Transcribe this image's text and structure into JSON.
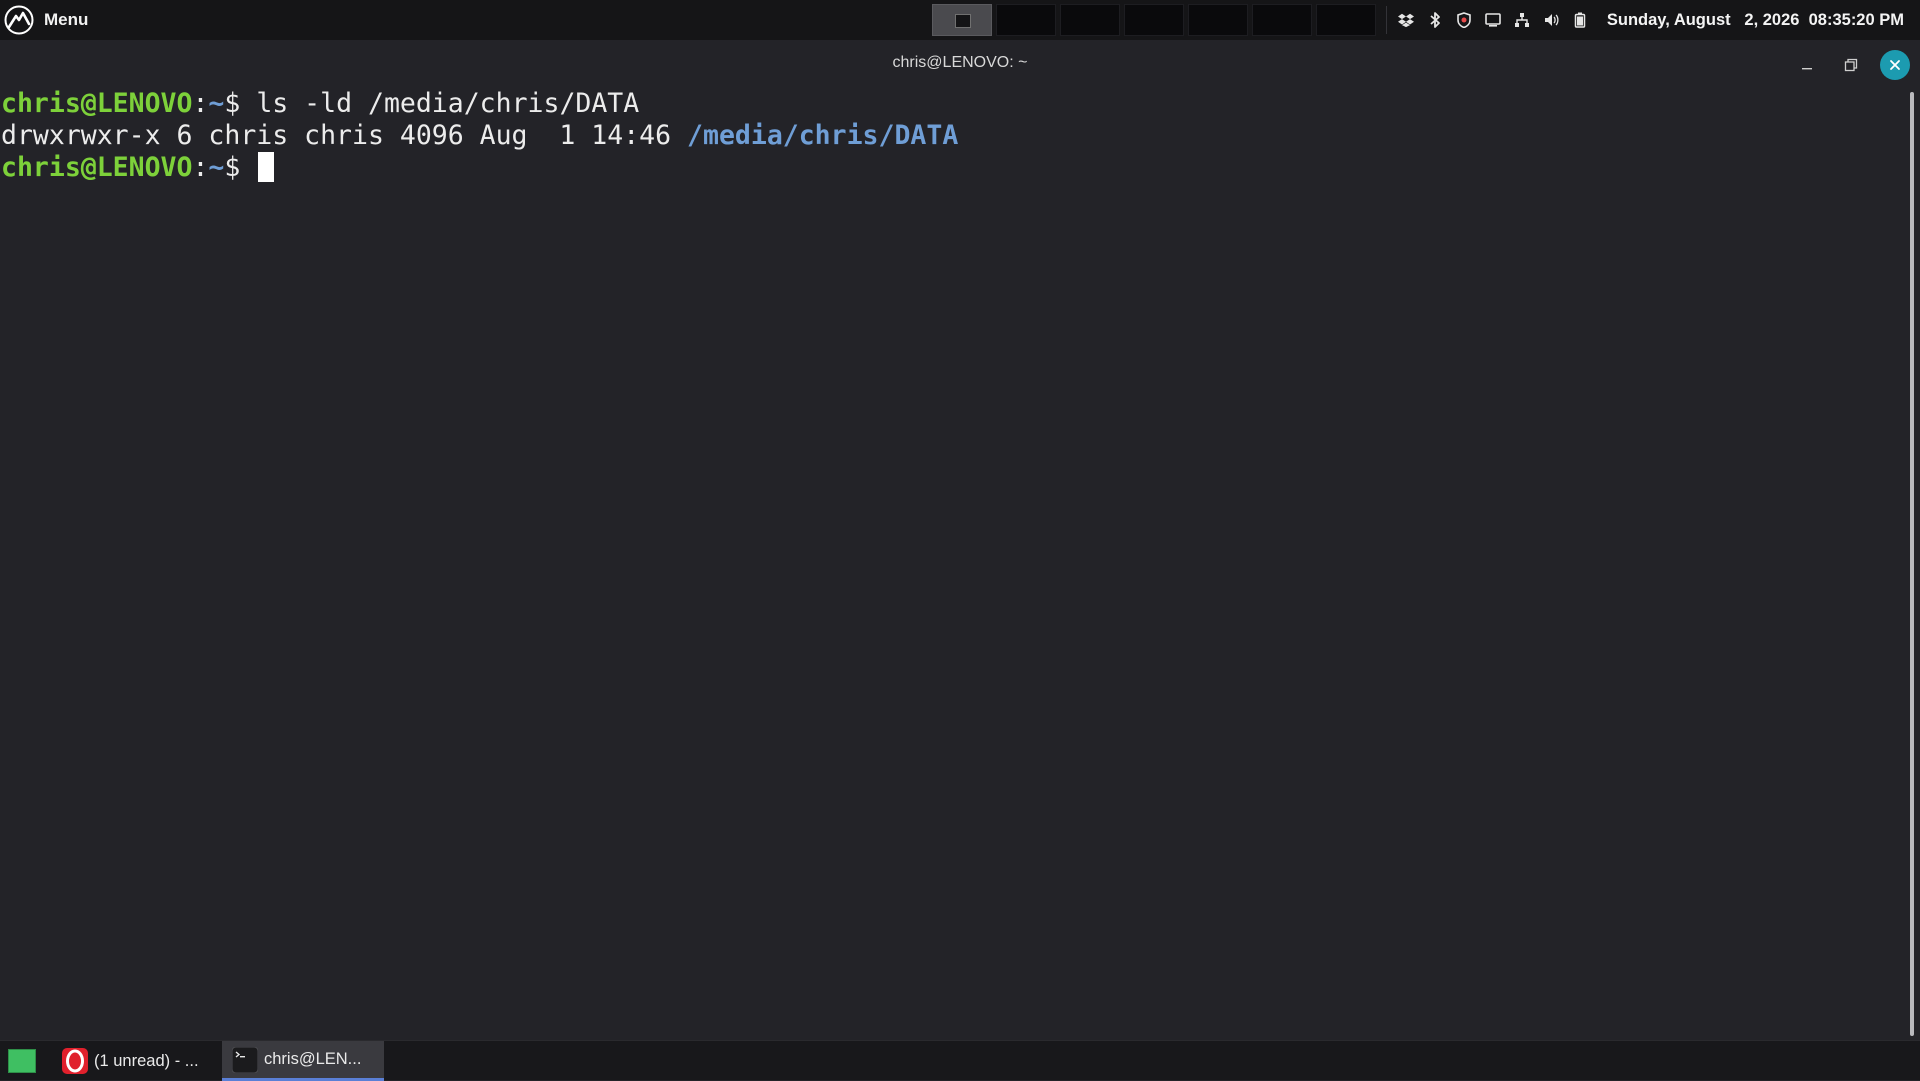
{
  "top_panel": {
    "menu_label": "Menu",
    "workspace_count": 7,
    "active_workspace": 1,
    "tray_icons": [
      "dropbox-icon",
      "bluetooth-icon",
      "shield-icon",
      "display-icon",
      "network-icon",
      "volume-icon",
      "battery-icon"
    ],
    "clock": "Sunday, August   2, 2026  08:35:20 PM"
  },
  "terminal": {
    "title": "chris@LENOVO: ~",
    "lines": [
      {
        "user_host": "chris@LENOVO",
        "colon": ":",
        "path": "~",
        "symbol": "$ ",
        "command": "ls -ld /media/chris/DATA"
      },
      {
        "output_plain": "drwxrwxr-x 6 chris chris 4096 Aug  1 14:46 ",
        "output_dir": "/media/chris/DATA"
      },
      {
        "user_host": "chris@LENOVO",
        "colon": ":",
        "path": "~",
        "symbol": "$ ",
        "command": ""
      }
    ]
  },
  "taskbar": {
    "items": [
      {
        "label": "(1 unread) - ...",
        "icon": "opera-icon"
      },
      {
        "label": "chris@LEN...",
        "icon": "terminal-icon",
        "active": true
      }
    ]
  },
  "colors": {
    "prompt_user": "#7dd13a",
    "prompt_path": "#6f9ed6",
    "close_button": "#1c9bb0",
    "show_desktop": "#3fbf62",
    "opera_red": "#e0202c"
  }
}
